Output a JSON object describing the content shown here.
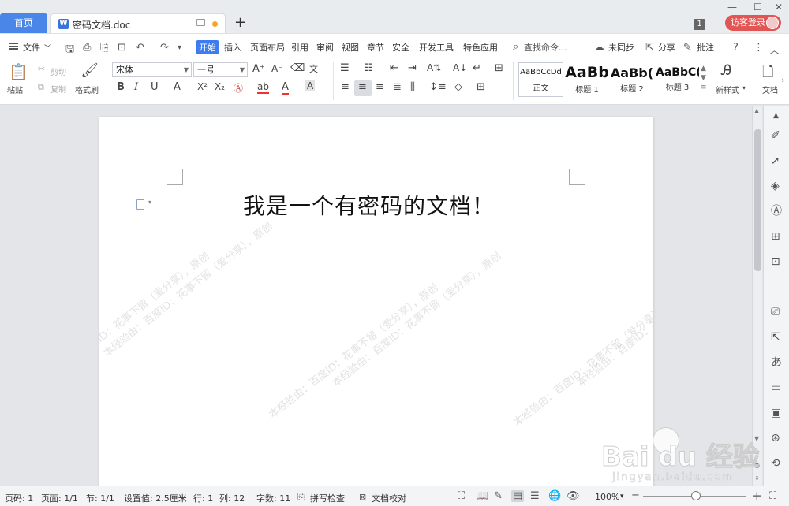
{
  "tabbar": {
    "home_tab": "首页",
    "doc_tab": "密码文档.doc",
    "doc_icon_letter": "W",
    "badge": "1",
    "login": "访客登录",
    "new_tab_icon": "plus-icon"
  },
  "menu": {
    "file": "文件",
    "tabs": [
      "开始",
      "插入",
      "页面布局",
      "引用",
      "审阅",
      "视图",
      "章节",
      "安全",
      "开发工具",
      "特色应用"
    ],
    "active_tab": "开始",
    "search_placeholder": "查找命令...",
    "sync": "未同步",
    "share": "分享",
    "comment": "批注"
  },
  "ribbon": {
    "paste": "粘贴",
    "cut": "剪切",
    "copy": "复制",
    "format_painter": "格式刷",
    "font_name": "宋体",
    "font_size": "一号",
    "bold": "B",
    "italic": "I",
    "underline": "U",
    "styles": [
      {
        "sample": "AaBbCcDd",
        "label": "正文"
      },
      {
        "sample": "AaBb",
        "label": "标题 1"
      },
      {
        "sample": "AaBb(",
        "label": "标题 2"
      },
      {
        "sample": "AaBbC(",
        "label": "标题 3"
      }
    ],
    "new_style": "新样式",
    "doc_tool": "文档"
  },
  "document": {
    "body_text": "我是一个有密码的文档！",
    "watermark": "本经验由：百度ID：花事不留（爱分享），原创"
  },
  "statusbar": {
    "page_no": "页码: 1",
    "pages": "页面: 1/1",
    "section": "节: 1/1",
    "setting": "设置值: 2.5厘米",
    "row": "行: 1",
    "col": "列: 12",
    "word_count": "字数: 11",
    "spell_check": "拼写检查",
    "doc_proof": "文档校对",
    "zoom": "100%"
  },
  "baidu_logo": {
    "brand": "Bai du 经验",
    "url": "jingyan.baidu.com"
  }
}
